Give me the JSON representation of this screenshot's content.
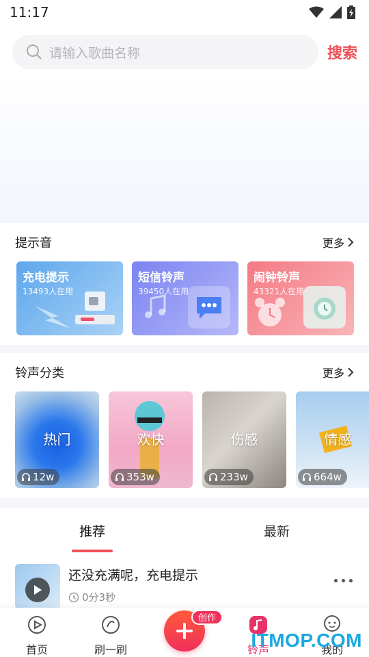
{
  "status_bar": {
    "time": "11:17"
  },
  "search": {
    "placeholder": "请输入歌曲名称",
    "button_label": "搜索"
  },
  "tones_section": {
    "title": "提示音",
    "more_label": "更多",
    "cards": [
      {
        "title": "充电提示",
        "subtitle": "13493人在用",
        "color": "#6fb3ee"
      },
      {
        "title": "短信铃声",
        "subtitle": "39450人在用",
        "color": "#8b8ff0"
      },
      {
        "title": "闹钟铃声",
        "subtitle": "43321人在用",
        "color": "#f2858c"
      }
    ]
  },
  "category_section": {
    "title": "铃声分类",
    "more_label": "更多",
    "cards": [
      {
        "label": "热门",
        "count": "12w"
      },
      {
        "label": "欢快",
        "count": "353w"
      },
      {
        "label": "伤感",
        "count": "233w"
      },
      {
        "label": "情感",
        "count": "664w"
      }
    ]
  },
  "tabs": {
    "recommend": "推荐",
    "latest": "最新"
  },
  "song": {
    "title": "还没充满呢，充电提示",
    "duration": "0分3秒"
  },
  "bottom_nav": {
    "home": "首页",
    "swipe": "刷一刷",
    "create_badge": "创作",
    "ringtone": "铃声",
    "mine": "我的"
  },
  "watermark": "ITMOP.COM",
  "colors": {
    "accent": "#f0505a",
    "active_nav": "#e8336a"
  }
}
